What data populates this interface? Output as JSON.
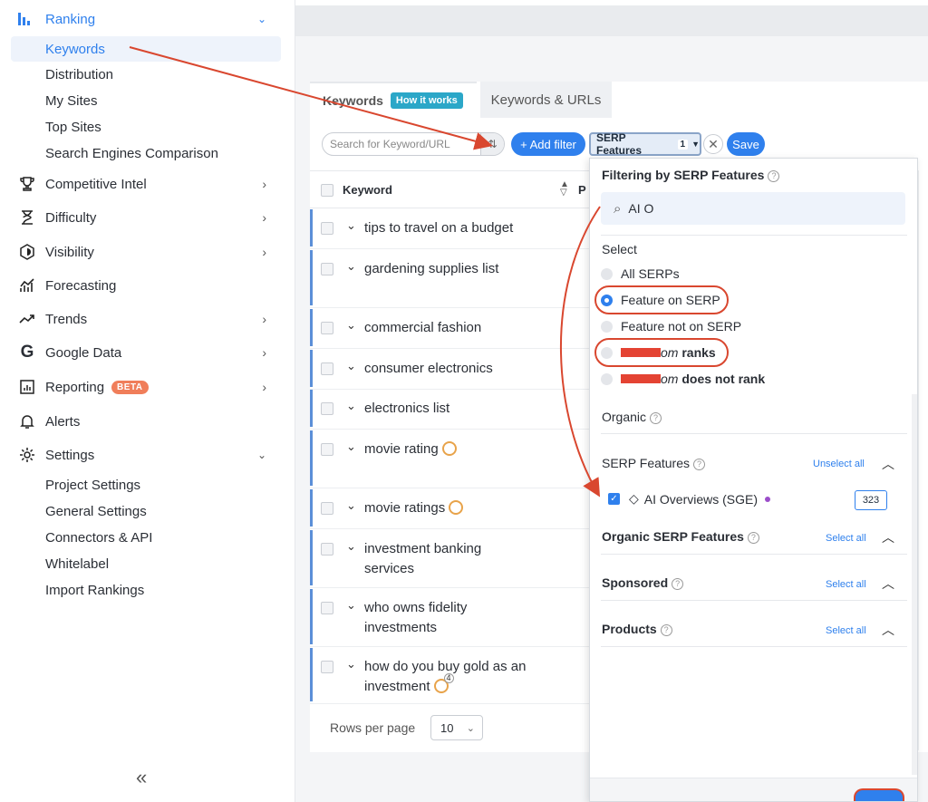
{
  "sidebar": {
    "ranking": "Ranking",
    "ranking_items": [
      "Keywords",
      "Distribution",
      "My Sites",
      "Top Sites",
      "Search Engines Comparison"
    ],
    "groups": [
      {
        "label": "Competitive Intel",
        "icon": "trophy-icon"
      },
      {
        "label": "Difficulty",
        "icon": "hourglass-icon"
      },
      {
        "label": "Visibility",
        "icon": "visibility-icon"
      },
      {
        "label": "Forecasting",
        "icon": "forecast-icon"
      },
      {
        "label": "Trends",
        "icon": "trend-icon"
      },
      {
        "label": "Google Data",
        "icon": "google-icon"
      },
      {
        "label": "Reporting",
        "icon": "report-icon",
        "badge": "BETA"
      },
      {
        "label": "Alerts",
        "icon": "bell-icon"
      },
      {
        "label": "Settings",
        "icon": "gear-icon"
      }
    ],
    "settings_items": [
      "Project Settings",
      "General Settings",
      "Connectors & API",
      "Whitelabel",
      "Import Rankings"
    ],
    "collapse": "«"
  },
  "tabs": {
    "keywords": "Keywords",
    "how_it_works": "How it works",
    "keywords_urls": "Keywords & URLs"
  },
  "toolbar": {
    "search_placeholder": "Search for Keyword/URL",
    "add_filter": "+ Add filter",
    "serp_chip": "SERP Features",
    "serp_chip_count": "1",
    "save": "Save"
  },
  "table": {
    "header_keyword": "Keyword",
    "header_p": "P",
    "rows": [
      {
        "keyword": "tips to travel on a budget"
      },
      {
        "keyword": "gardening supplies list"
      },
      {
        "keyword": "commercial fashion"
      },
      {
        "keyword": "consumer electronics"
      },
      {
        "keyword": "electronics list"
      },
      {
        "keyword": "movie rating",
        "sge": true
      },
      {
        "keyword": "movie ratings",
        "sge": true
      },
      {
        "keyword": "investment banking services"
      },
      {
        "keyword": "who owns fidelity investments"
      },
      {
        "keyword": "how do you buy gold as an investment",
        "sge": true,
        "sge_count": "4"
      }
    ],
    "rows_per_page_label": "Rows per page",
    "rows_per_page_value": "10"
  },
  "filter_panel": {
    "title": "Filtering by SERP Features",
    "search_value": "AI O",
    "select_label": "Select",
    "options": [
      {
        "label": "All SERPs",
        "selected": false
      },
      {
        "label": "Feature on SERP",
        "selected": true
      },
      {
        "label": "Feature not on SERP",
        "selected": false
      },
      {
        "prefix": "om",
        "suffix": "ranks",
        "selected": false
      },
      {
        "prefix": "om",
        "suffix": "does not rank",
        "selected": false
      }
    ],
    "organic": "Organic",
    "serp_features": "SERP Features",
    "unselect_all": "Unselect all",
    "feature_item": "AI Overviews (SGE)",
    "feature_count": "323",
    "organic_serp_features": "Organic SERP Features",
    "sponsored": "Sponsored",
    "products": "Products",
    "select_all": "Select all"
  },
  "colors": {
    "accent": "#2f80ed",
    "annotation": "#d9472f"
  }
}
